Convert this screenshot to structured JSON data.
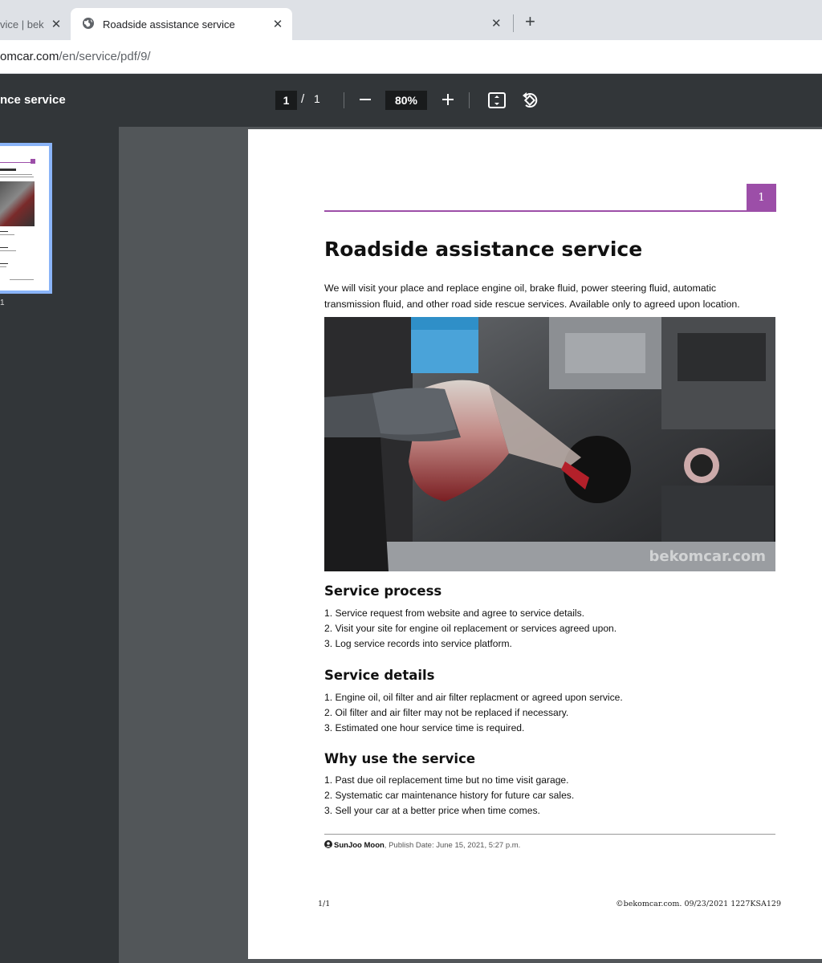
{
  "browser": {
    "tabs": [
      {
        "title": "vice | bek",
        "active": false
      },
      {
        "title": "Roadside assistance service",
        "active": true
      }
    ],
    "url_host": "omcar.com",
    "url_path": "/en/service/pdf/9/"
  },
  "pdf_toolbar": {
    "title": "nce service",
    "current_page": "1",
    "page_separator": "/",
    "total_pages": "1",
    "zoom": "80%"
  },
  "sidebar": {
    "thumbnail_page": "1"
  },
  "document": {
    "page_number_box": "1",
    "title": "Roadside assistance service",
    "intro": "We will visit your place and replace engine oil, brake fluid, power steering fluid, automatic transmission fluid, and other road side rescue services. Available only to agreed upon location.",
    "image_watermark": "bekomcar.com",
    "sections": [
      {
        "heading": "Service process",
        "items": [
          "1. Service request from website and agree to service details.",
          "2. Visit your site for engine oil replacement or services agreed upon.",
          "3. Log service records into service platform."
        ]
      },
      {
        "heading": "Service details",
        "items": [
          "1. Engine oil, oil filter and air filter replacment or agreed upon service.",
          "2. Oil filter and air filter may not be replaced if necessary.",
          "3. Estimated one hour service time is required."
        ]
      },
      {
        "heading": "Why use the service",
        "items": [
          "1. Past due oil replacement time but no time visit garage.",
          "2. Systematic car maintenance history for future car sales.",
          "3. Sell your car at a better price when time comes."
        ]
      }
    ],
    "author": "SunJoo Moon",
    "publish_text": ", Publish Date: June 15, 2021, 5:27 p.m.",
    "footer_left": "1/1",
    "footer_right": "©bekomcar.com. 09/23/2021 1227KSA129"
  },
  "colors": {
    "accent": "#9c4ea8",
    "toolbar": "#323639",
    "viewer_bg": "#525659",
    "thumb_border": "#8ab4f8"
  }
}
